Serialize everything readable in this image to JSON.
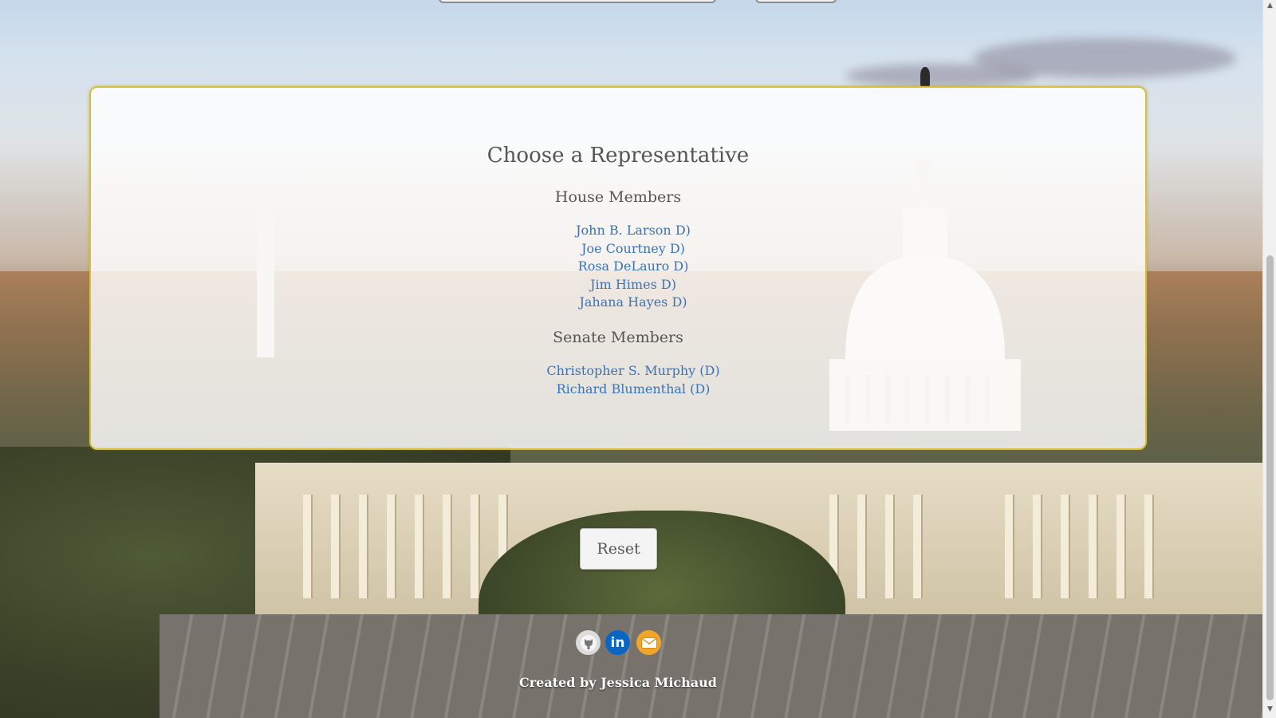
{
  "card": {
    "title": "Choose a Representative",
    "house_heading": "House Members",
    "house_members": [
      "John B. Larson D)",
      "Joe Courtney D)",
      "Rosa DeLauro D)",
      "Jim Himes D)",
      "Jahana Hayes D)"
    ],
    "senate_heading": "Senate Members",
    "senate_members": [
      "Christopher S. Murphy (D)",
      "Richard Blumenthal (D)"
    ]
  },
  "reset_label": "Reset",
  "footer": {
    "icons": [
      "github-icon",
      "linkedin-icon",
      "email-icon"
    ],
    "linkedin_text": "in",
    "credit": "Created by Jessica Michaud"
  },
  "colors": {
    "accent_border": "#d7bf3a",
    "link": "#3b73b5"
  }
}
